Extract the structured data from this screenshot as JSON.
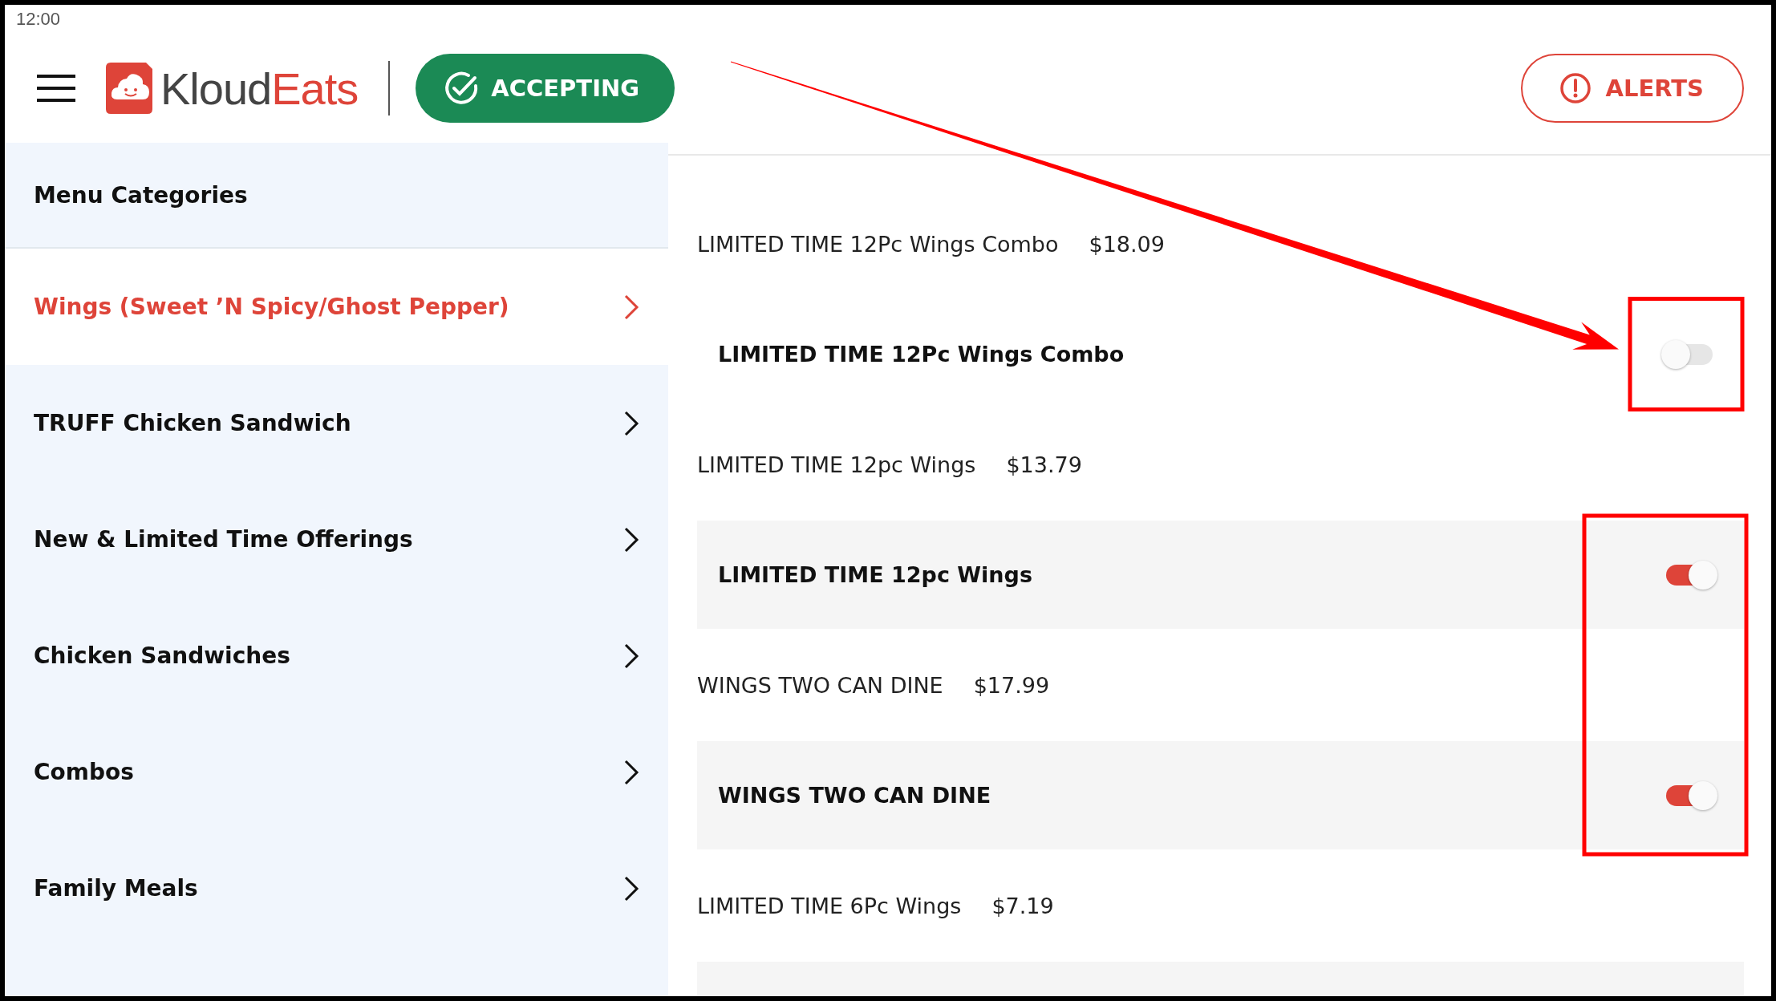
{
  "status_bar": {
    "time": "12:00"
  },
  "header": {
    "logo": {
      "first": "Kloud",
      "second": "Eats"
    },
    "status_button": {
      "label": "ACCEPTING"
    },
    "alerts_button": {
      "label": "ALERTS"
    }
  },
  "sidebar": {
    "title": "Menu Categories",
    "items": [
      {
        "label": "Wings (Sweet ’N Spicy/Ghost Pepper)",
        "selected": true
      },
      {
        "label": "TRUFF Chicken Sandwich",
        "selected": false
      },
      {
        "label": "New & Limited Time Offerings",
        "selected": false
      },
      {
        "label": "Chicken Sandwiches",
        "selected": false
      },
      {
        "label": "Combos",
        "selected": false
      },
      {
        "label": "Family Meals",
        "selected": false
      }
    ]
  },
  "products": [
    {
      "name": "LIMITED TIME 12Pc Wings Combo",
      "price": "$18.09",
      "toggle_label": "LIMITED TIME 12Pc Wings Combo",
      "on": false,
      "boxed": true,
      "arrow": true
    },
    {
      "name": "LIMITED TIME 12pc Wings",
      "price": "$13.79",
      "toggle_label": "LIMITED TIME 12pc Wings",
      "on": true,
      "boxed": true,
      "arrow": false
    },
    {
      "name": "WINGS TWO CAN DINE",
      "price": "$17.99",
      "toggle_label": "WINGS TWO CAN DINE",
      "on": true,
      "boxed": true,
      "arrow": false
    },
    {
      "name": "LIMITED TIME 6Pc Wings",
      "price": "$7.19"
    }
  ]
}
